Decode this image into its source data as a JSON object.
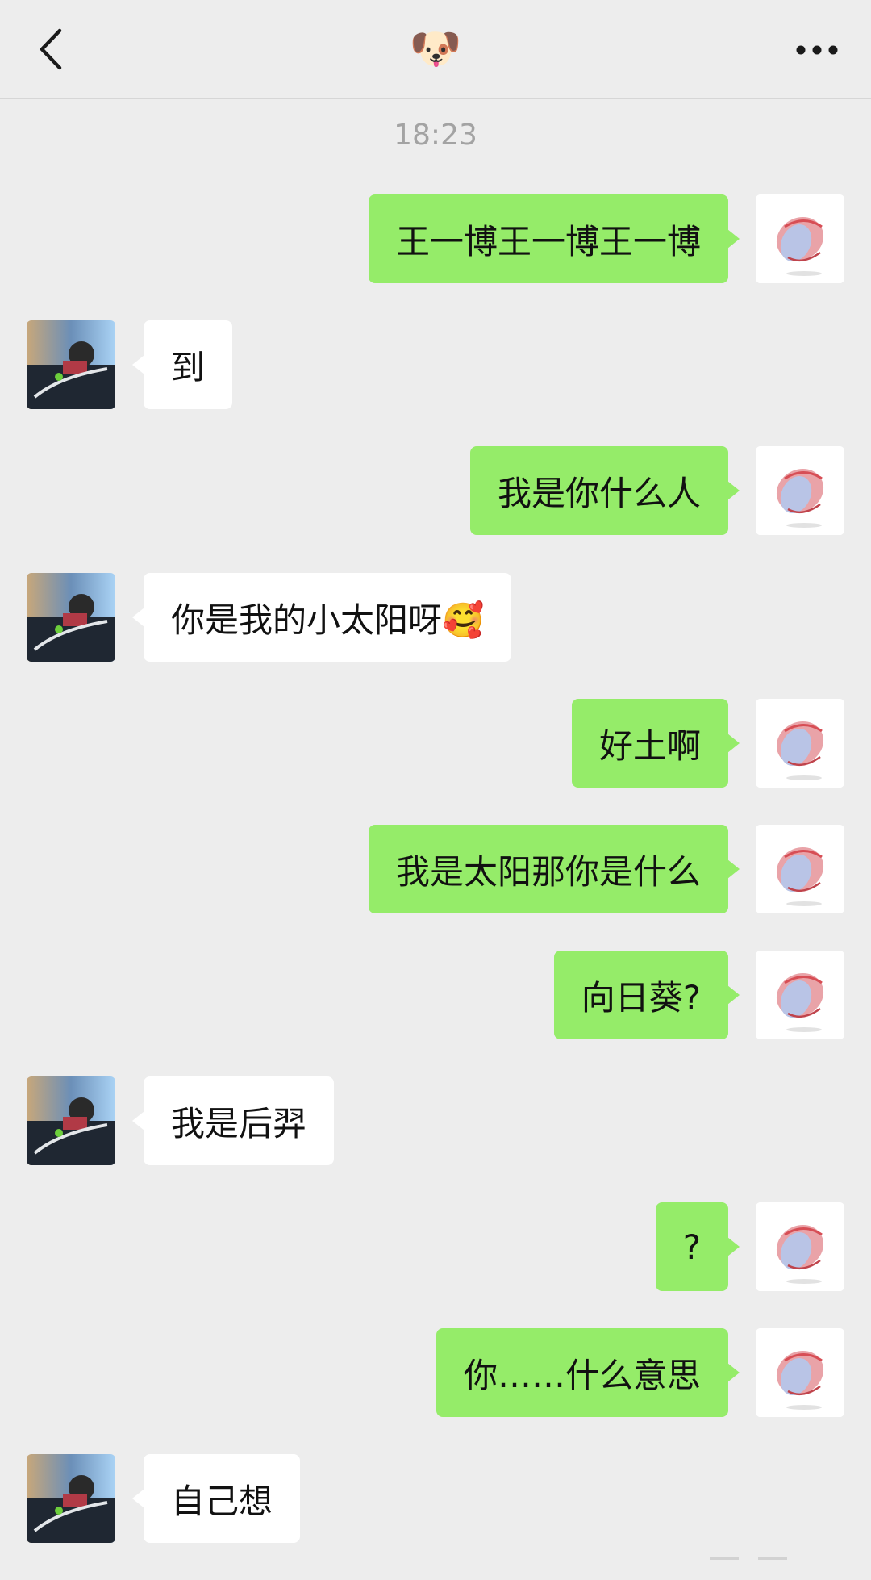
{
  "header": {
    "back_icon": "chevron-left-icon",
    "title_emoji": "🐶",
    "more_icon": "more-dots-icon"
  },
  "timestamp": "18:23",
  "messages": [
    {
      "side": "right",
      "text": "王一博王一博王一博"
    },
    {
      "side": "left",
      "text": "到"
    },
    {
      "side": "right",
      "text": "我是你什么人"
    },
    {
      "side": "left",
      "text": "你是我的小太阳呀🥰"
    },
    {
      "side": "right",
      "text": "好土啊"
    },
    {
      "side": "right",
      "text": "我是太阳那你是什么"
    },
    {
      "side": "right",
      "text": "向日葵?"
    },
    {
      "side": "left",
      "text": "我是后羿"
    },
    {
      "side": "right",
      "text": "?"
    },
    {
      "side": "right",
      "text": "你……什么意思"
    },
    {
      "side": "left",
      "text": "自己想"
    }
  ],
  "colors": {
    "background": "#ededed",
    "sent_bubble": "#95ec69",
    "received_bubble": "#ffffff",
    "timestamp_text": "#a3a3a3"
  }
}
